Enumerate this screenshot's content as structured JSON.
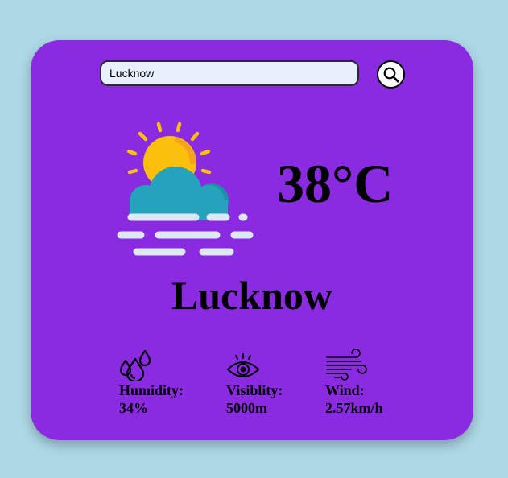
{
  "search": {
    "value": "Lucknow",
    "icon": "search-icon"
  },
  "weather": {
    "icon": "partly-sunny-fog-icon",
    "temperature": "38°C",
    "city": "Lucknow"
  },
  "stats": {
    "humidity": {
      "icon": "humidity-drops-icon",
      "label": "Humidity:",
      "value": "34%"
    },
    "visibility": {
      "icon": "eye-icon",
      "label": "Visiblity:",
      "value": "5000m"
    },
    "wind": {
      "icon": "wind-icon",
      "label": "Wind:",
      "value": "2.57km/h"
    }
  },
  "colors": {
    "background": "#add8e6",
    "card": "#8a2be2",
    "sun": "#fbbf0d",
    "cloud": "#25a3bd",
    "fog": "#dce9f5"
  }
}
